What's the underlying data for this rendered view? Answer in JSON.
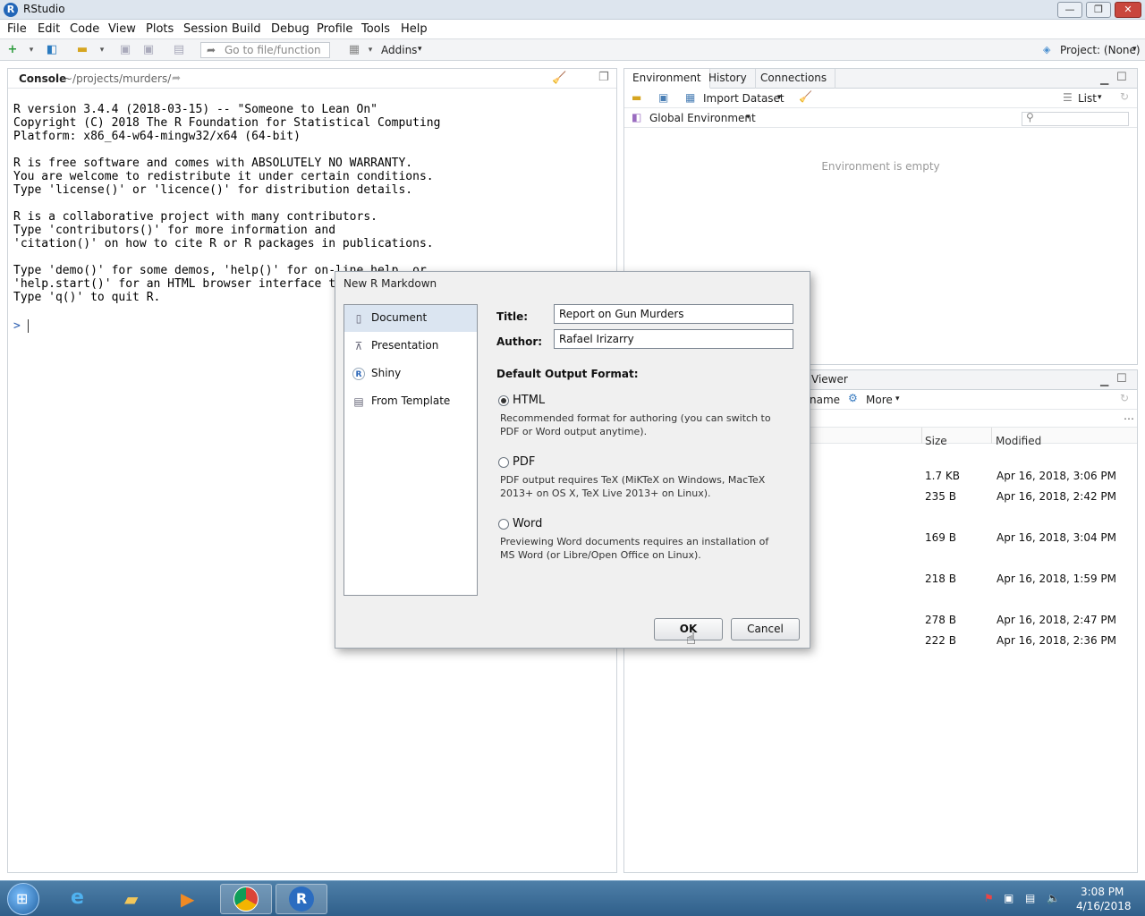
{
  "window": {
    "title": "RStudio",
    "minimize": "—",
    "restore": "❐",
    "close": "✕"
  },
  "menu": [
    "File",
    "Edit",
    "Code",
    "View",
    "Plots",
    "Session",
    "Build",
    "Debug",
    "Profile",
    "Tools",
    "Help"
  ],
  "toolbar": {
    "goto_placeholder": "Go to file/function",
    "addins": "Addins",
    "project": "Project: (None)"
  },
  "console": {
    "tab": "Console",
    "path": "~/projects/murders/",
    "lines": "R version 3.4.4 (2018-03-15) -- \"Someone to Lean On\"\nCopyright (C) 2018 The R Foundation for Statistical Computing\nPlatform: x86_64-w64-mingw32/x64 (64-bit)\n\nR is free software and comes with ABSOLUTELY NO WARRANTY.\nYou are welcome to redistribute it under certain conditions.\nType 'license()' or 'licence()' for distribution details.\n\nR is a collaborative project with many contributors.\nType 'contributors()' for more information and\n'citation()' on how to cite R or R packages in publications.\n\nType 'demo()' for some demos, 'help()' for on-line help, or\n'help.start()' for an HTML browser interface to help.\nType 'q()' to quit R.",
    "prompt": ">"
  },
  "environment": {
    "tabs": [
      "Environment",
      "History",
      "Connections"
    ],
    "import": "Import Dataset",
    "view": "List",
    "scope": "Global Environment",
    "empty": "Environment is empty"
  },
  "files": {
    "tab_visible": "Viewer",
    "rename_partial": "name",
    "more": "More",
    "col_size": "Size",
    "col_modified": "Modified",
    "rows": [
      {
        "size": "1.7 KB",
        "modified": "Apr 16, 2018, 3:06 PM"
      },
      {
        "size": "235 B",
        "modified": "Apr 16, 2018, 2:42 PM"
      },
      {
        "size": "169 B",
        "modified": "Apr 16, 2018, 3:04 PM"
      },
      {
        "size": "218 B",
        "modified": "Apr 16, 2018, 1:59 PM"
      },
      {
        "size": "278 B",
        "modified": "Apr 16, 2018, 2:47 PM"
      },
      {
        "size": "222 B",
        "modified": "Apr 16, 2018, 2:36 PM"
      }
    ]
  },
  "dialog": {
    "title": "New R Markdown",
    "types": [
      "Document",
      "Presentation",
      "Shiny",
      "From Template"
    ],
    "title_label": "Title:",
    "title_value": "Report on Gun Murders",
    "author_label": "Author:",
    "author_value": "Rafael Irizarry",
    "format_heading": "Default Output Format:",
    "formats": [
      {
        "name": "HTML",
        "desc": "Recommended format for authoring (you can switch to PDF or Word output anytime)."
      },
      {
        "name": "PDF",
        "desc": "PDF output requires TeX (MiKTeX on Windows, MacTeX 2013+ on OS X, TeX Live 2013+ on Linux)."
      },
      {
        "name": "Word",
        "desc": "Previewing Word documents requires an installation of MS Word (or Libre/Open Office on Linux)."
      }
    ],
    "selected_format": "HTML",
    "ok": "OK",
    "cancel": "Cancel"
  },
  "taskbar": {
    "time": "3:08 PM",
    "date": "4/16/2018"
  }
}
